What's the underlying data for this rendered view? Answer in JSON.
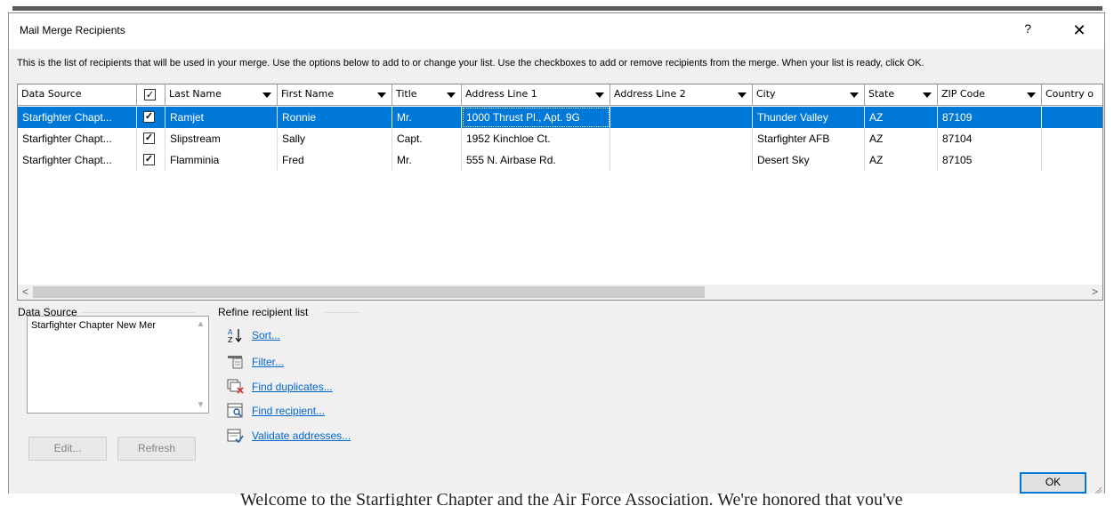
{
  "dialog": {
    "title": "Mail Merge Recipients",
    "help_label": "?",
    "close_label": "✕",
    "instructions": "This is the list of recipients that will be used in your merge.  Use the options below to add to or change your list.  Use the checkboxes to add or remove recipients from the merge.  When your list is ready, click OK."
  },
  "grid": {
    "columns": [
      "Data Source",
      "",
      "Last Name",
      "First Name",
      "Title",
      "Address Line 1",
      "Address Line 2",
      "City",
      "State",
      "ZIP Code",
      "Country o"
    ],
    "header_check": "✓",
    "rows": [
      {
        "source": "Starfighter Chapt...",
        "checked": "✓",
        "last": "Ramjet",
        "first": "Ronnie",
        "title": "Mr.",
        "addr1": "1000 Thrust Pl., Apt. 9G",
        "addr2": "",
        "city": "Thunder Valley",
        "state": "AZ",
        "zip": "87109",
        "country": ""
      },
      {
        "source": "Starfighter Chapt...",
        "checked": "✓",
        "last": "Slipstream",
        "first": "Sally",
        "title": "Capt.",
        "addr1": "1952 Kinchloe Ct.",
        "addr2": "",
        "city": "Starfighter AFB",
        "state": "AZ",
        "zip": "87104",
        "country": ""
      },
      {
        "source": "Starfighter Chapt...",
        "checked": "✓",
        "last": "Flamminia",
        "first": "Fred",
        "title": "Mr.",
        "addr1": "555 N. Airbase Rd.",
        "addr2": "",
        "city": "Desert Sky",
        "state": "AZ",
        "zip": "87105",
        "country": ""
      }
    ],
    "scroll_left": "<",
    "scroll_right": ">"
  },
  "data_source": {
    "label": "Data Source",
    "item": "Starfighter Chapter New Mer",
    "edit_label": "Edit...",
    "refresh_label": "Refresh"
  },
  "refine": {
    "label": "Refine recipient list",
    "sort": "Sort...",
    "filter": "Filter...",
    "duplicates": "Find duplicates...",
    "find": "Find recipient...",
    "validate": "Validate addresses..."
  },
  "ok_label": "OK",
  "backdrop_text": "Welcome to the Starfighter Chapter and the Air Force Association.  We're honored that you've"
}
